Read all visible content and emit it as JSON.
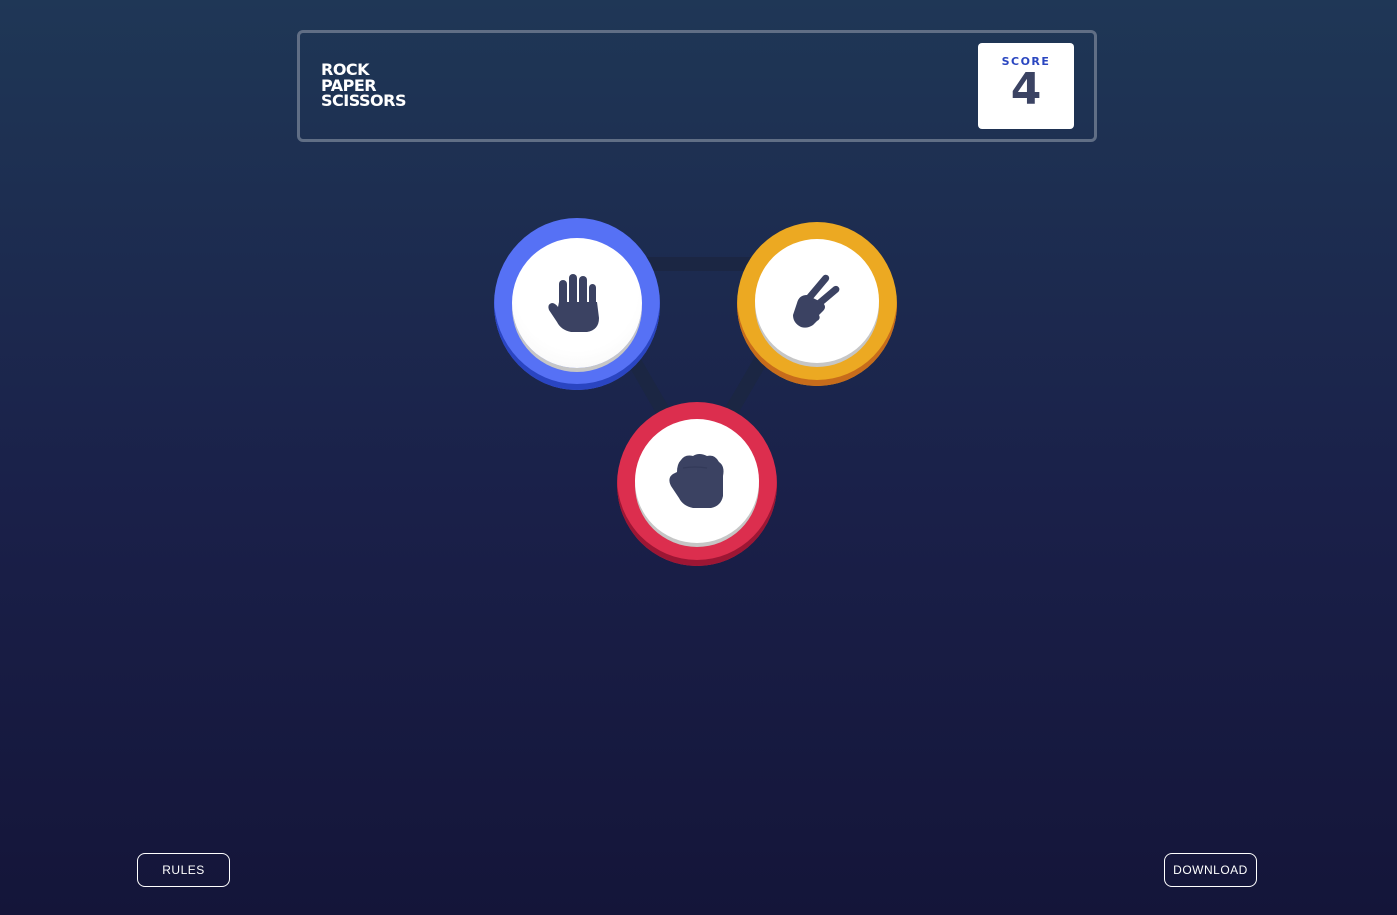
{
  "game": {
    "title_lines": [
      "ROCK",
      "PAPER",
      "SCISSORS"
    ]
  },
  "score": {
    "label": "SCORE",
    "value": "4"
  },
  "tokens": [
    {
      "choice": "paper",
      "icon": "hand-paper-icon",
      "ring_color": "#5671f5"
    },
    {
      "choice": "scissors",
      "icon": "hand-scissors-icon",
      "ring_color": "#eca922"
    },
    {
      "choice": "rock",
      "icon": "hand-rock-icon",
      "ring_color": "#dc2e4e"
    }
  ],
  "footer": {
    "rules_label": "RULES",
    "download_label": "DOWNLOAD"
  },
  "colors": {
    "background_top": "#1f3756",
    "background_bottom": "#141539",
    "score_text": "#3b4363",
    "score_label": "#2a46c0"
  }
}
